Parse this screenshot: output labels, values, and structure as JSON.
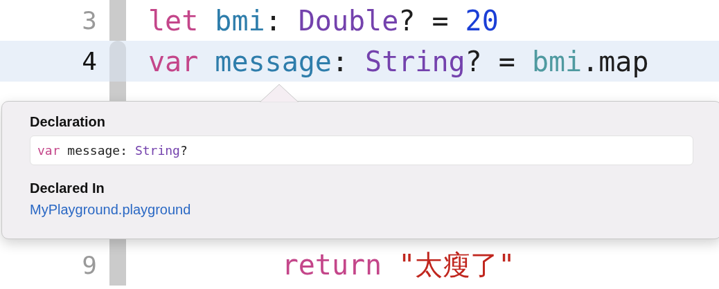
{
  "editor": {
    "lines": [
      {
        "number": "3",
        "current": false,
        "tokens": [
          {
            "text": "let ",
            "kind": "keyword"
          },
          {
            "text": "bmi",
            "kind": "declared"
          },
          {
            "text": ": ",
            "kind": "plain"
          },
          {
            "text": "Double",
            "kind": "type"
          },
          {
            "text": "? = ",
            "kind": "plain"
          },
          {
            "text": "20",
            "kind": "number"
          }
        ]
      },
      {
        "number": "4",
        "current": true,
        "tokens": [
          {
            "text": "var ",
            "kind": "keyword"
          },
          {
            "text": "message",
            "kind": "declared"
          },
          {
            "text": ": ",
            "kind": "plain"
          },
          {
            "text": "String",
            "kind": "type"
          },
          {
            "text": "? = ",
            "kind": "plain"
          },
          {
            "text": "bmi",
            "kind": "reference"
          },
          {
            "text": ".map",
            "kind": "plain"
          }
        ]
      },
      {
        "number": "9",
        "current": false,
        "tokens": [
          {
            "text": "        return ",
            "kind": "keyword"
          },
          {
            "text": "\"太瘦了\"",
            "kind": "string"
          }
        ]
      }
    ]
  },
  "popover": {
    "sections": [
      {
        "heading": "Declaration",
        "kind": "code",
        "tokens": [
          {
            "text": "var",
            "kind": "keyword"
          },
          {
            "text": " message: ",
            "kind": "plain"
          },
          {
            "text": "String",
            "kind": "type"
          },
          {
            "text": "?",
            "kind": "plain"
          }
        ]
      },
      {
        "heading": "Declared In",
        "kind": "link",
        "text": "MyPlayground.playground"
      }
    ]
  }
}
